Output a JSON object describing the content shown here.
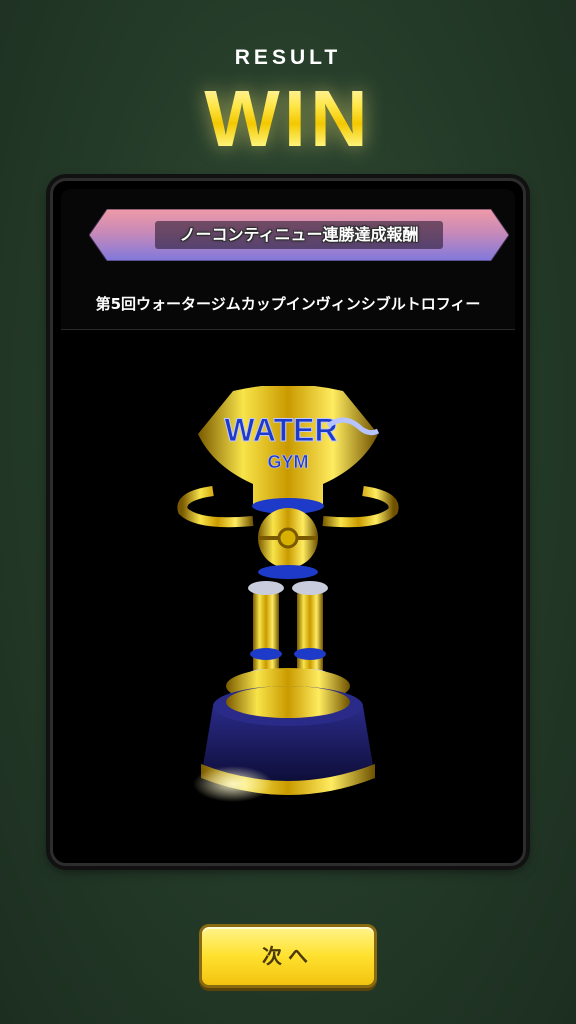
{
  "header": {
    "result_label": "RESULT",
    "win_label": "WIN"
  },
  "reward": {
    "ribbon_label": "ノーコンティニュー連勝達成報酬",
    "item_name": "第5回ウォータージムカップインヴィンシブルトロフィー",
    "trophy_text_top": "WATER",
    "trophy_text_sub": "GYM"
  },
  "footer": {
    "next_button_label": "次へ"
  },
  "colors": {
    "background": "#243a28",
    "panel": "#000000",
    "accent_gold": "#f3c800",
    "ribbon_top": "#e48a9a",
    "ribbon_bottom": "#8a7ad8",
    "trophy_blue": "#1e3ac8"
  }
}
